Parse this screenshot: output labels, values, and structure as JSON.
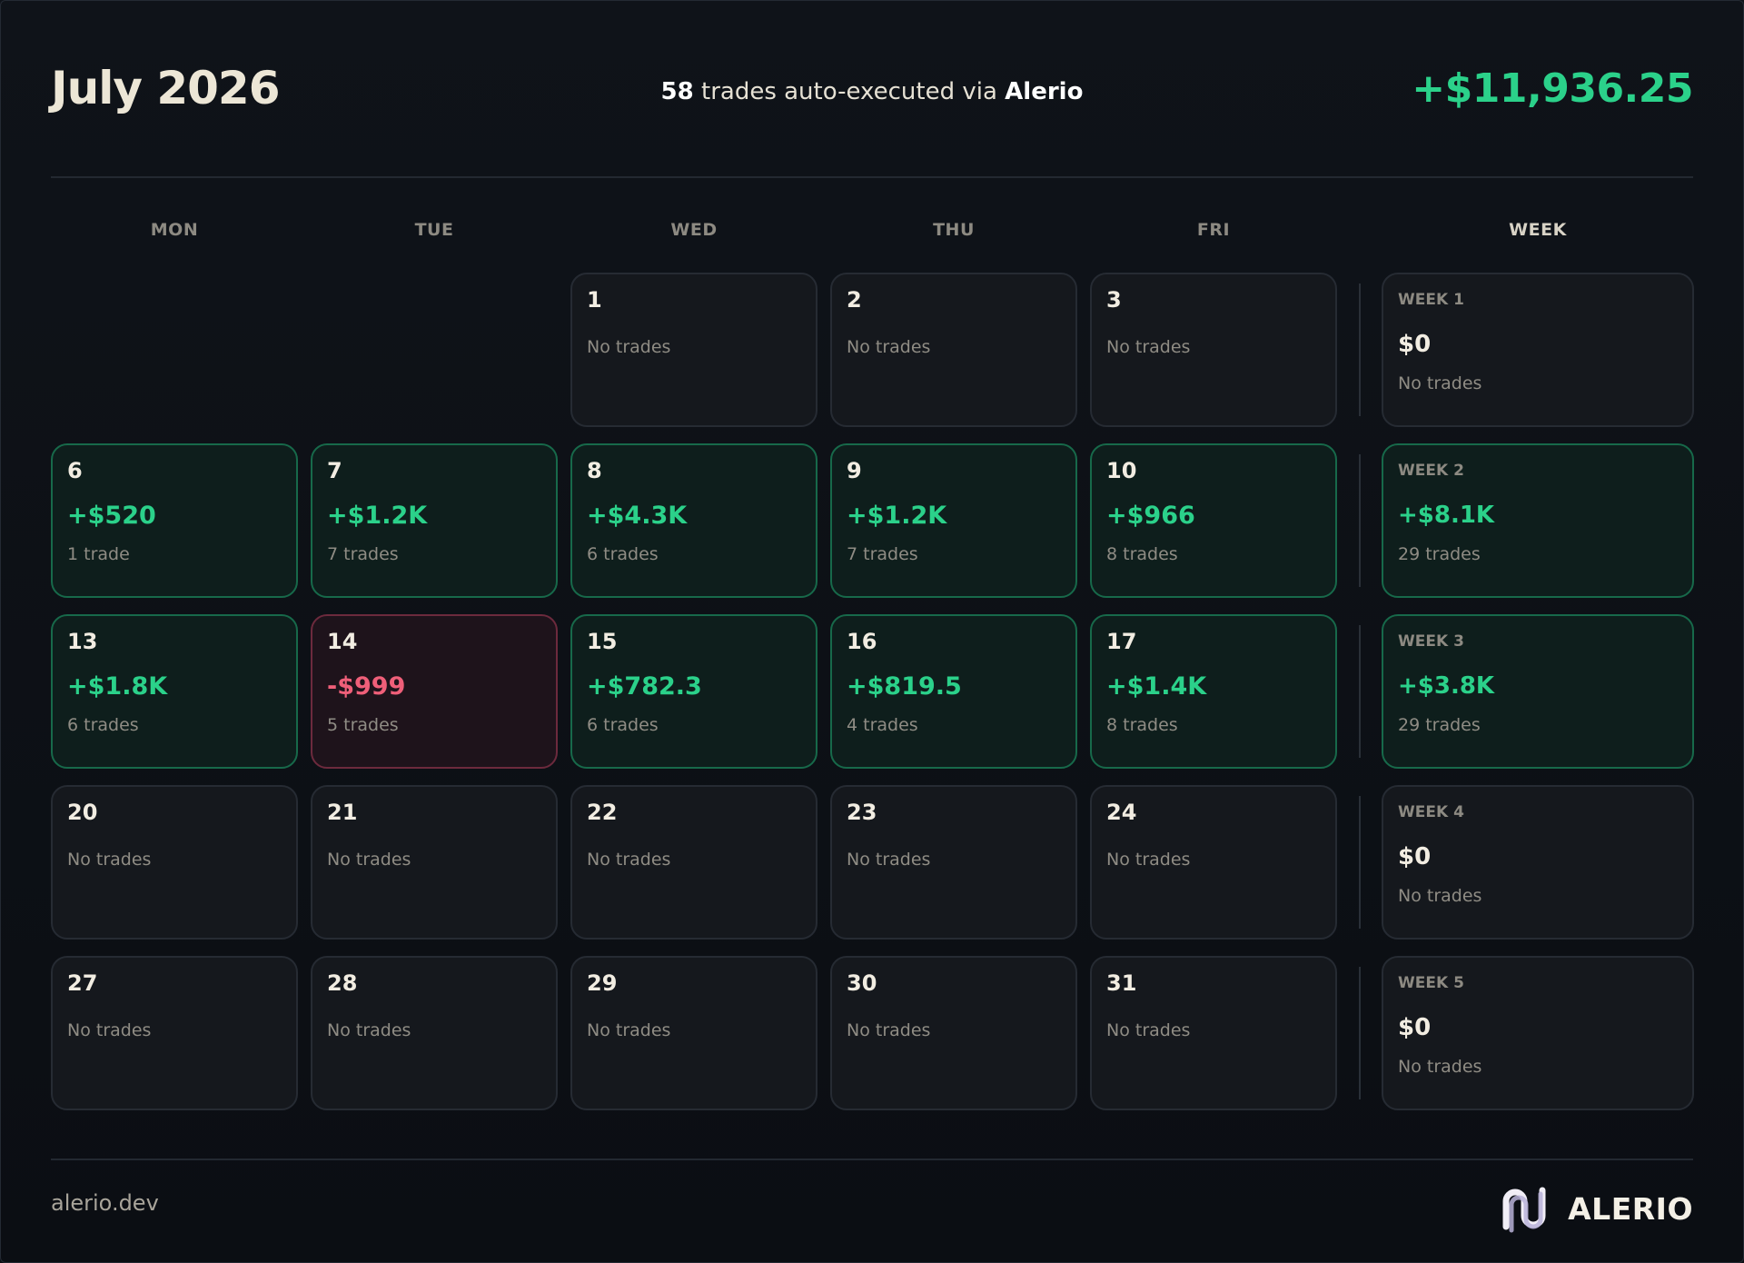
{
  "header": {
    "title": "July 2026",
    "trade_count": "58",
    "subtitle_mid": " trades auto-executed via ",
    "brand": "Alerio",
    "total": "+$11,936.25"
  },
  "weekdays": [
    "MON",
    "TUE",
    "WED",
    "THU",
    "FRI",
    "WEEK"
  ],
  "colors": {
    "positive": "#2bd18a",
    "negative": "#ef5f79",
    "accent": "#1f8f63"
  },
  "weeks": [
    {
      "days": [
        null,
        null,
        {
          "num": "1",
          "note": "No trades"
        },
        {
          "num": "2",
          "note": "No trades"
        },
        {
          "num": "3",
          "note": "No trades"
        }
      ],
      "summary": {
        "label": "WEEK 1",
        "value": "$0",
        "note": "No trades"
      }
    },
    {
      "days": [
        {
          "num": "6",
          "pnl": "+$520",
          "note": "1 trade"
        },
        {
          "num": "7",
          "pnl": "+$1.2K",
          "note": "7 trades"
        },
        {
          "num": "8",
          "pnl": "+$4.3K",
          "note": "6 trades"
        },
        {
          "num": "9",
          "pnl": "+$1.2K",
          "note": "7 trades"
        },
        {
          "num": "10",
          "pnl": "+$966",
          "note": "8 trades"
        }
      ],
      "summary": {
        "label": "WEEK 2",
        "value": "+$8.1K",
        "note": "29 trades"
      }
    },
    {
      "days": [
        {
          "num": "13",
          "pnl": "+$1.8K",
          "note": "6 trades"
        },
        {
          "num": "14",
          "pnl": "-$999",
          "note": "5 trades"
        },
        {
          "num": "15",
          "pnl": "+$782.3",
          "note": "6 trades"
        },
        {
          "num": "16",
          "pnl": "+$819.5",
          "note": "4 trades"
        },
        {
          "num": "17",
          "pnl": "+$1.4K",
          "note": "8 trades"
        }
      ],
      "summary": {
        "label": "WEEK 3",
        "value": "+$3.8K",
        "note": "29 trades"
      }
    },
    {
      "days": [
        {
          "num": "20",
          "note": "No trades"
        },
        {
          "num": "21",
          "note": "No trades"
        },
        {
          "num": "22",
          "note": "No trades"
        },
        {
          "num": "23",
          "note": "No trades"
        },
        {
          "num": "24",
          "note": "No trades"
        }
      ],
      "summary": {
        "label": "WEEK 4",
        "value": "$0",
        "note": "No trades"
      }
    },
    {
      "days": [
        {
          "num": "27",
          "note": "No trades"
        },
        {
          "num": "28",
          "note": "No trades"
        },
        {
          "num": "29",
          "note": "No trades"
        },
        {
          "num": "30",
          "note": "No trades"
        },
        {
          "num": "31",
          "note": "No trades"
        }
      ],
      "summary": {
        "label": "WEEK 5",
        "value": "$0",
        "note": "No trades"
      }
    }
  ],
  "footer": {
    "url": "alerio.dev",
    "logo_text": "ALERIO",
    "logo_icon": "alerio-logo-icon"
  }
}
